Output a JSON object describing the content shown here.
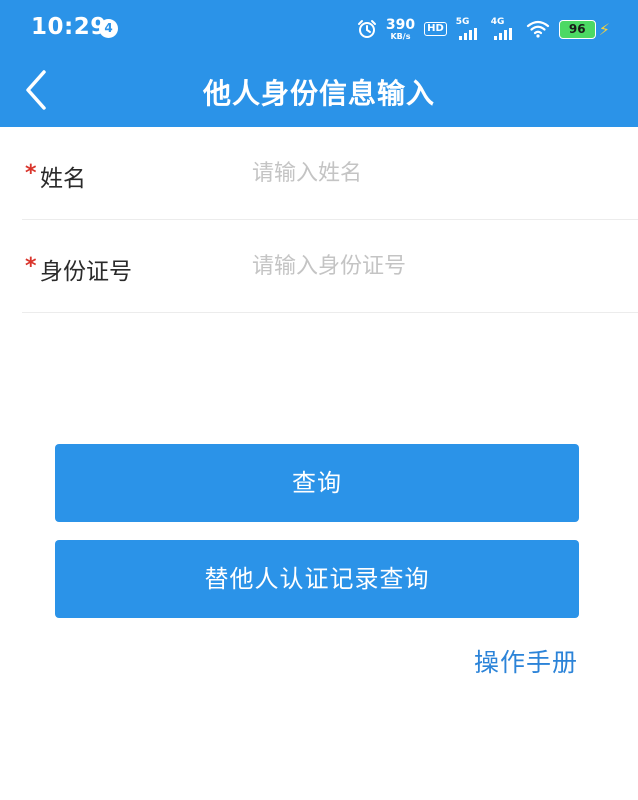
{
  "status_bar": {
    "time": "10:29",
    "notification_count": "4",
    "net_speed_value": "390",
    "net_speed_unit": "KB/s",
    "hd_label": "HD",
    "sim1_label": "5G",
    "sim2_label": "4G",
    "battery_level": "96"
  },
  "header": {
    "title": "他人身份信息输入"
  },
  "form": {
    "name": {
      "label": "姓名",
      "required_mark": "*",
      "placeholder": "请输入姓名"
    },
    "id_number": {
      "label": "身份证号",
      "required_mark": "*",
      "placeholder": "请输入身份证号"
    }
  },
  "actions": {
    "query_label": "查询",
    "records_label": "替他人认证记录查询",
    "manual_label": "操作手册"
  },
  "colors": {
    "primary": "#2b93e8",
    "required": "#d9342b",
    "link": "#2b83d8",
    "battery": "#4cd964"
  }
}
